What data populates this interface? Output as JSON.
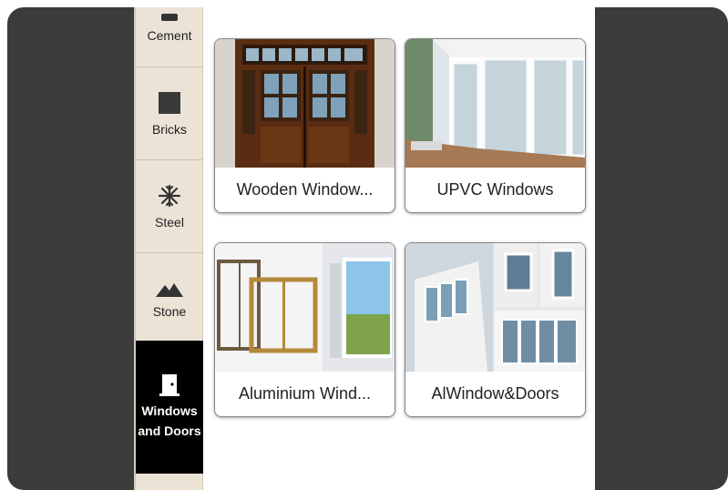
{
  "sidebar": {
    "items": [
      {
        "label": "Cement",
        "icon": "cement-icon"
      },
      {
        "label": "Bricks",
        "icon": "brick-icon"
      },
      {
        "label": "Steel",
        "icon": "snowflake-icon"
      },
      {
        "label": "Stone",
        "icon": "mountain-icon"
      },
      {
        "label": "Windows and Doors",
        "icon": "door-icon",
        "active": true
      }
    ]
  },
  "products": [
    {
      "label": "Wooden Window..."
    },
    {
      "label": "UPVC Windows"
    },
    {
      "label": "Aluminium Wind..."
    },
    {
      "label": "AlWindow&Doors"
    }
  ],
  "colors": {
    "sidebar_bg": "#ebe3d6",
    "active_bg": "#000000",
    "frame": "#3b3b3b"
  }
}
